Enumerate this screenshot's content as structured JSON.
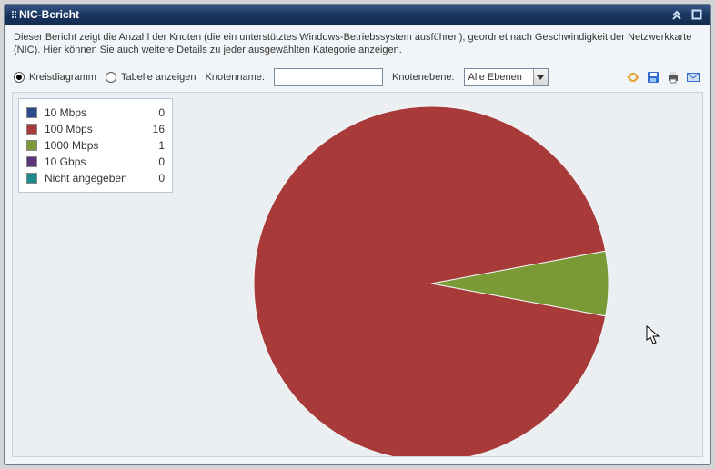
{
  "window": {
    "title": "NIC-Bericht"
  },
  "description": "Dieser Bericht zeigt die Anzahl der Knoten (die ein unterstütztes Windows-Betriebssystem ausführen), geordnet nach Geschwindigkeit der Netzwerkkarte (NIC). Hier können Sie auch weitere Details zu jeder ausgewählten Kategorie anzeigen.",
  "toolbar": {
    "view_pie": "Kreisdiagramm",
    "view_table": "Tabelle anzeigen",
    "nodename_label": "Knotenname:",
    "nodename_value": "",
    "nodelevel_label": "Knotenebene:",
    "nodelevel_value": "Alle Ebenen"
  },
  "legend": {
    "items": [
      {
        "label": "10 Mbps",
        "value": "0",
        "color": "#2a4a8a"
      },
      {
        "label": "100 Mbps",
        "value": "16",
        "color": "#a83a3a"
      },
      {
        "label": "1000 Mbps",
        "value": "1",
        "color": "#7a9a37"
      },
      {
        "label": "10 Gbps",
        "value": "0",
        "color": "#5a357a"
      },
      {
        "label": "Nicht angegeben",
        "value": "0",
        "color": "#1a8a8a"
      }
    ]
  },
  "chart_data": {
    "type": "pie",
    "title": "NIC-Bericht",
    "series": [
      {
        "name": "10 Mbps",
        "value": 0,
        "color": "#2a4a8a"
      },
      {
        "name": "100 Mbps",
        "value": 16,
        "color": "#a83a3a"
      },
      {
        "name": "1000 Mbps",
        "value": 1,
        "color": "#7a9a37"
      },
      {
        "name": "10 Gbps",
        "value": 0,
        "color": "#5a357a"
      },
      {
        "name": "Nicht angegeben",
        "value": 0,
        "color": "#1a8a8a"
      }
    ]
  }
}
